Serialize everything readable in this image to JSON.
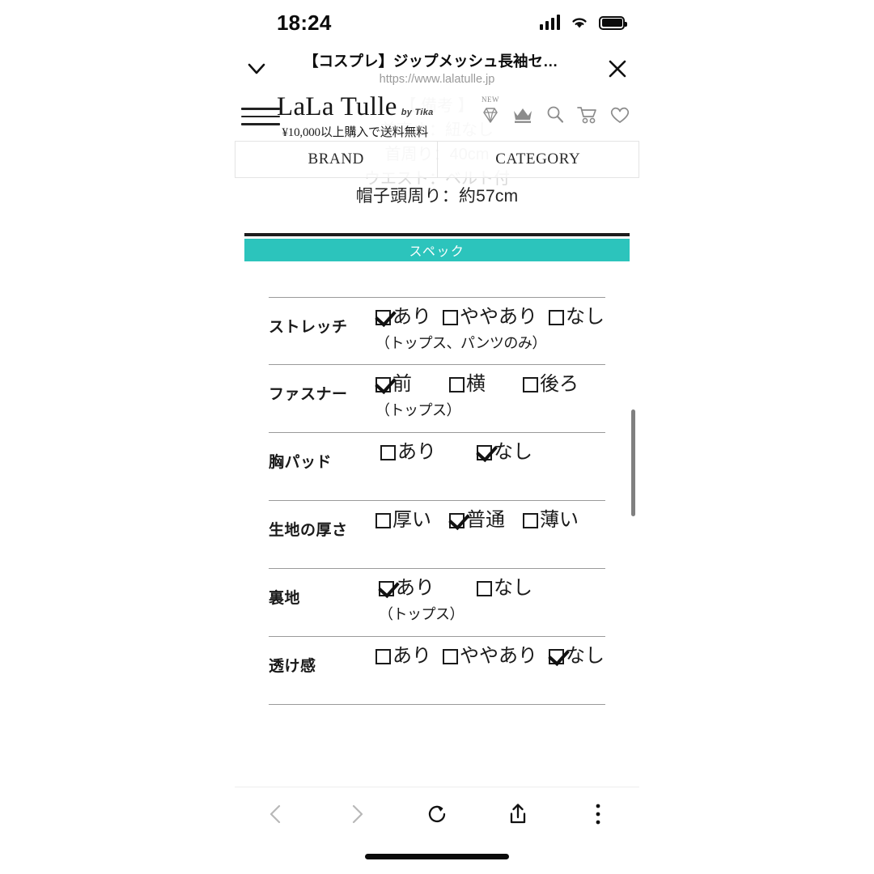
{
  "status_bar": {
    "time": "18:24",
    "signal_icon": "cellular-signal-icon",
    "wifi_icon": "wifi-icon",
    "battery_icon": "battery-full-icon"
  },
  "browser_bar": {
    "collapse_icon": "chevron-down-icon",
    "title": "【コスプレ】ジップメッシュ長袖セクシー…",
    "url": "https://www.lalatulle.jp",
    "close_icon": "close-icon"
  },
  "site_header": {
    "menu_icon": "hamburger-menu-icon",
    "brand_name": "LaLa Tulle",
    "brand_byline": "by Tika",
    "shipping_note": "¥10,000以上購入で送料無料",
    "icons": [
      {
        "name": "new-diamond-icon",
        "badge": "NEW"
      },
      {
        "name": "crown-icon",
        "badge": ""
      },
      {
        "name": "search-icon",
        "badge": ""
      },
      {
        "name": "cart-icon",
        "badge": ""
      },
      {
        "name": "heart-icon",
        "badge": ""
      }
    ]
  },
  "nav_tabs": [
    {
      "label": "BRAND"
    },
    {
      "label": "CATEGORY"
    }
  ],
  "page_content": {
    "ghost_lines": [
      "【 備考 】",
      "首高さ：紐なし",
      "首周り：40cm",
      "ウエスト：ベルト付"
    ],
    "visible_measure": "帽子頭周り：約57cm",
    "spec_banner_label": "スペック",
    "spec_banner_color": "#2cc4bc",
    "spec_rows": [
      {
        "label": "ストレッチ",
        "gap": "gap-a",
        "indent": "indent-1",
        "options": [
          {
            "text": "あり",
            "checked": true
          },
          {
            "text": "ややあり",
            "checked": false
          },
          {
            "text": "なし",
            "checked": false
          }
        ],
        "note": "（トップス、パンツのみ）"
      },
      {
        "label": "ファスナー",
        "gap": "gap-b",
        "indent": "indent-1",
        "options": [
          {
            "text": "前",
            "checked": true
          },
          {
            "text": "横",
            "checked": false
          },
          {
            "text": "後ろ",
            "checked": false
          }
        ],
        "note": "（トップス）"
      },
      {
        "label": "胸パッド",
        "gap": "gap-c",
        "indent": "indent-2",
        "options": [
          {
            "text": "あり",
            "checked": false
          },
          {
            "text": "なし",
            "checked": true
          }
        ],
        "note": ""
      },
      {
        "label": "生地の厚さ",
        "gap": "gap-d",
        "indent": "indent-1",
        "options": [
          {
            "text": "厚い",
            "checked": false
          },
          {
            "text": "普通",
            "checked": true
          },
          {
            "text": "薄い",
            "checked": false
          }
        ],
        "note": ""
      },
      {
        "label": "裏地",
        "gap": "gap-e",
        "indent": "indent-3",
        "options": [
          {
            "text": "あり",
            "checked": true
          },
          {
            "text": "なし",
            "checked": false
          }
        ],
        "note": "（トップス）"
      },
      {
        "label": "透け感",
        "gap": "gap-a",
        "indent": "indent-1",
        "options": [
          {
            "text": "あり",
            "checked": false
          },
          {
            "text": "ややあり",
            "checked": false
          },
          {
            "text": "なし",
            "checked": true
          }
        ],
        "note": ""
      }
    ]
  },
  "toolbar": [
    {
      "name": "back-button",
      "icon": "chevron-left-icon",
      "enabled": false
    },
    {
      "name": "forward-button",
      "icon": "chevron-right-icon",
      "enabled": false
    },
    {
      "name": "reload-button",
      "icon": "reload-icon",
      "enabled": true
    },
    {
      "name": "share-button",
      "icon": "share-icon",
      "enabled": true
    },
    {
      "name": "more-options-button",
      "icon": "kebab-menu-icon",
      "enabled": true
    }
  ]
}
